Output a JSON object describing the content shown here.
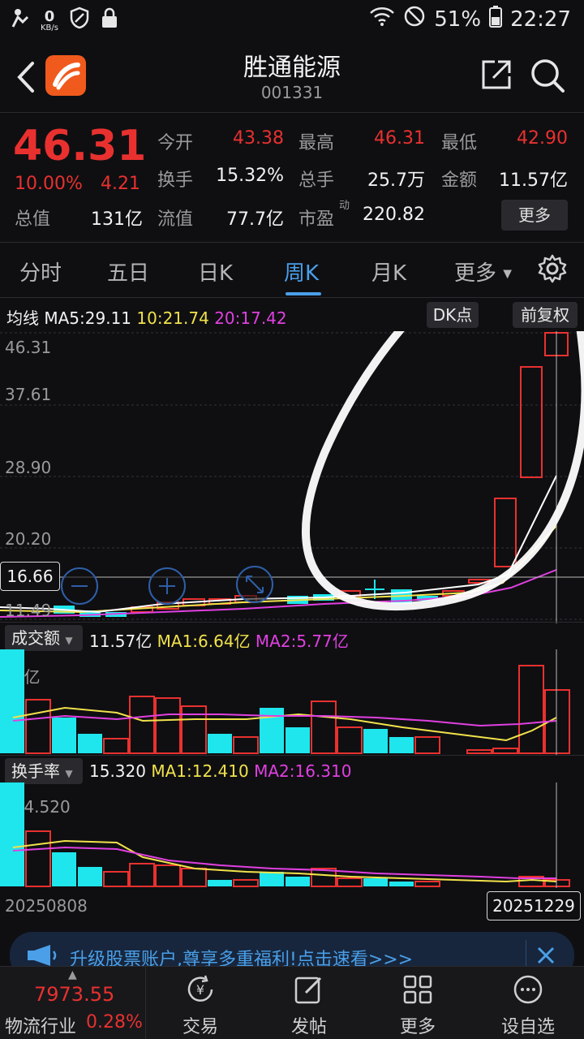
{
  "status_bar": {
    "kbs_value": "0",
    "kbs_unit": "KB/s",
    "battery": "51%",
    "time": "22:27"
  },
  "header": {
    "stock_name": "胜通能源",
    "stock_code": "001331"
  },
  "quote": {
    "price": "46.31",
    "change_pct": "10.00%",
    "change_amt": "4.21",
    "total_value_label": "总值",
    "total_value": "131亿",
    "open_label": "今开",
    "open": "43.38",
    "high_label": "最高",
    "high": "46.31",
    "low_label": "最低",
    "low": "42.90",
    "turnover_label": "换手",
    "turnover": "15.32%",
    "volume_label": "总手",
    "volume": "25.7万",
    "amount_label": "金额",
    "amount": "11.57亿",
    "float_label": "流值",
    "float_value": "77.7亿",
    "pe_label": "市盈",
    "pe_sup": "动",
    "pe": "220.82",
    "more_label": "更多"
  },
  "tabs": {
    "items": [
      "分时",
      "五日",
      "日K",
      "周K",
      "月K",
      "更多"
    ],
    "active": "周K"
  },
  "kline": {
    "ma_title": "均线",
    "ma5": "MA5:29.11",
    "ma10": "10:21.74",
    "ma20": "20:17.42",
    "dk_label": "DK点",
    "adjust_label": "前复权",
    "y_labels": [
      "46.31",
      "37.61",
      "28.90",
      "20.20",
      "11.49"
    ],
    "crosshair_value": "16.66",
    "colors": {
      "up": "#e8312f",
      "down": "#1ee6ec",
      "ma5": "#ffffff",
      "ma10": "#f1e24a",
      "ma20": "#e040e0"
    }
  },
  "volume_panel": {
    "selector": "成交额",
    "value": "11.57亿",
    "ma1": "MA1:6.64亿",
    "ma2": "MA2:5.77亿",
    "max_label": "18亿"
  },
  "turnover_panel": {
    "selector": "换手率",
    "value": "15.320",
    "ma1": "MA1:12.410",
    "ma2": "MA2:16.310",
    "max_label": "194.520"
  },
  "date_axis": {
    "start": "20250808",
    "end": "20251229"
  },
  "banner": {
    "text": "升级股票账户,尊享多重福利!点击速看>>>"
  },
  "bottom_nav": {
    "index_value": "7973.55",
    "index_name": "物流行业",
    "index_change": "0.28%",
    "items": [
      "交易",
      "发帖",
      "更多",
      "设自选"
    ]
  }
}
